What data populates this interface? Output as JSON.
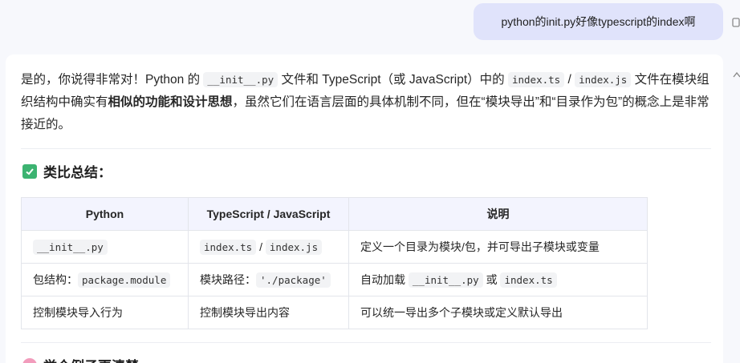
{
  "user_message": "python的init.py好像typescript的index啊",
  "answer": {
    "intro": {
      "p1": "是的，你说得非常对！Python 的 ",
      "code1": "__init__.py",
      "p2": " 文件和 TypeScript（或 JavaScript）中的 ",
      "code2": "index.ts",
      "p3": " / ",
      "code3": "index.js",
      "p4": " 文件在模块组织结构中确实有",
      "bold": "相似的功能和设计思想",
      "p5": "，虽然它们在语言层面的具体机制不同，但在“模块导出”和“目录作为包”的概念上是非常接近的。"
    },
    "section_title": "类比总结：",
    "table": {
      "headers": [
        "Python",
        "TypeScript / JavaScript",
        "说明"
      ],
      "rows": [
        {
          "c1_code": "__init__.py",
          "c2_code_a": "index.ts",
          "c2_sep": " / ",
          "c2_code_b": "index.js",
          "c3": "定义一个目录为模块/包，并可导出子模块或变量"
        },
        {
          "c1_text": "包结构：",
          "c1_code": "package.module",
          "c2_text": "模块路径：",
          "c2_code": "'./package'",
          "c3_text": "自动加载 ",
          "c3_code_a": "__init__.py",
          "c3_sep": " 或 ",
          "c3_code_b": "index.ts"
        },
        {
          "c1": "控制模块导入行为",
          "c2": "控制模块导出内容",
          "c3": "可以统一导出多个子模块或定义默认导出"
        }
      ]
    },
    "next_section_title": "举个例子更清楚"
  },
  "icons": {
    "copy": "copy-icon",
    "collapse": "chevron-up-icon",
    "section": "check-mark-button-icon",
    "next_section": "pink-circle-icon"
  },
  "colors": {
    "user_bubble": "#e0e3fb",
    "table_header": "#f3f4fe",
    "check_icon": "#3cb371"
  }
}
